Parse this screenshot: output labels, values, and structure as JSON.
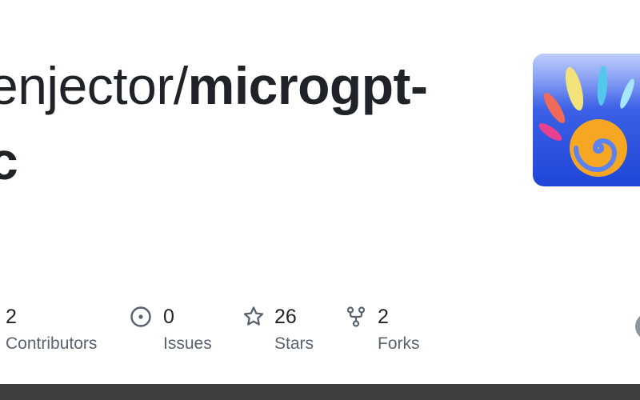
{
  "repo": {
    "owner": "enjector",
    "separator": "/",
    "name_line1": "microgpt-",
    "name_line2": "c"
  },
  "stats": {
    "contributors": {
      "count": "2",
      "label": "Contributors",
      "icon": "people-icon"
    },
    "issues": {
      "count": "0",
      "label": "Issues",
      "icon": "issue-opened-icon"
    },
    "stars": {
      "count": "26",
      "label": "Stars",
      "icon": "star-icon"
    },
    "forks": {
      "count": "2",
      "label": "Forks",
      "icon": "repo-forked-icon"
    }
  },
  "colors": {
    "title": "#1f2328",
    "label": "#59636e",
    "icon": "#59636e",
    "bottom_bar": "#3d3e40",
    "logo_background": "#3f63e8"
  }
}
